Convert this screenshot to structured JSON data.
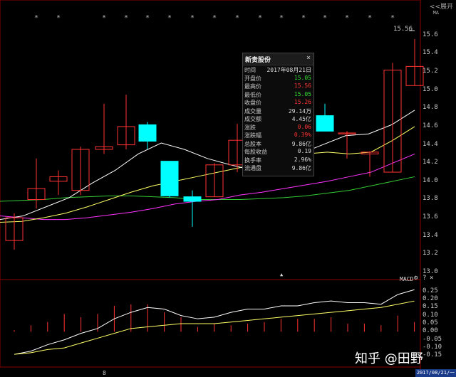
{
  "toolbar": {
    "expand_label": "<<展开"
  },
  "ma_label": "MA",
  "markers": [
    "*",
    "*",
    "*",
    "*",
    "*",
    "*",
    "*",
    "*",
    "*",
    "*",
    "*",
    "*",
    "*",
    "*",
    "*",
    "*"
  ],
  "price_axis": [
    "15.6",
    "15.4",
    "15.2",
    "15.0",
    "14.8",
    "14.6",
    "14.4",
    "14.2",
    "14.0",
    "13.8",
    "13.6",
    "13.4",
    "13.2",
    "13.0"
  ],
  "macd": {
    "title": "MACD",
    "gear": "⚙",
    "help": "?",
    "close": "×",
    "axis": [
      "0.25",
      "0.20",
      "0.15",
      "0.10",
      "0.05",
      "0.00",
      "-0.05",
      "-0.10",
      "-0.15"
    ],
    "bars": [
      0.01,
      0.04,
      0.06,
      0.11,
      0.09,
      0.11,
      0.16,
      0.17,
      0.17,
      0.12,
      0.09,
      0.03,
      0.05,
      0.04,
      0.05,
      0.06,
      0.08,
      0.08,
      0.08,
      0.09,
      0.05,
      0.05,
      0.04,
      0.1,
      0.06
    ],
    "dif": [
      -0.14,
      -0.12,
      -0.08,
      -0.05,
      -0.01,
      0.02,
      0.08,
      0.12,
      0.15,
      0.14,
      0.1,
      0.08,
      0.09,
      0.12,
      0.14,
      0.14,
      0.16,
      0.16,
      0.18,
      0.19,
      0.18,
      0.18,
      0.17,
      0.23,
      0.26
    ],
    "dea": [
      -0.14,
      -0.13,
      -0.11,
      -0.1,
      -0.07,
      -0.04,
      -0.01,
      0.02,
      0.03,
      0.04,
      0.05,
      0.05,
      0.05,
      0.06,
      0.07,
      0.08,
      0.09,
      0.1,
      0.11,
      0.12,
      0.13,
      0.14,
      0.15,
      0.17,
      0.19
    ]
  },
  "high_label": "15.56",
  "popup": {
    "title": "新贵股份",
    "close": "×",
    "rows": [
      {
        "k": "时间",
        "v": "2017年08月21日",
        "c": "#dddddd"
      },
      {
        "k": "开盘价",
        "v": "15.05",
        "c": "#33dd33"
      },
      {
        "k": "最高价",
        "v": "15.56",
        "c": "#ff3333"
      },
      {
        "k": "最低价",
        "v": "15.05",
        "c": "#33dd33"
      },
      {
        "k": "收盘价",
        "v": "15.26",
        "c": "#ff3333"
      },
      {
        "k": "成交量",
        "v": "29.14万",
        "c": "#dddddd"
      },
      {
        "k": "成交额",
        "v": "4.45亿",
        "c": "#dddddd"
      },
      {
        "k": "涨跌",
        "v": "0.06",
        "c": "#ff3333"
      },
      {
        "k": "涨跌幅",
        "v": "0.39%",
        "c": "#ff3333"
      },
      {
        "k": "总股本",
        "v": "9.86亿",
        "c": "#dddddd"
      },
      {
        "k": "每股收益",
        "v": "0.19",
        "c": "#dddddd"
      },
      {
        "k": "换手率",
        "v": "2.96%",
        "c": "#dddddd"
      },
      {
        "k": "流通盘",
        "v": "9.86亿",
        "c": "#dddddd"
      }
    ]
  },
  "watermark": "知乎 @田野",
  "date_box": "2017/08/21/一",
  "x_label": "8",
  "colors": {
    "up": "#ff3333",
    "down": "#00ffff",
    "ma5": "#ffffff",
    "ma10": "#ffff66",
    "ma20": "#ff33ff",
    "ma60": "#33cc33",
    "grid": "#8b0000"
  },
  "chart_data": {
    "type": "candlestick",
    "ylim": [
      13.0,
      15.7
    ],
    "candles": [
      {
        "o": 13.35,
        "c": 13.6,
        "h": 13.65,
        "l": 13.25
      },
      {
        "o": 13.8,
        "c": 13.92,
        "h": 14.25,
        "l": 13.7
      },
      {
        "o": 14.0,
        "c": 14.05,
        "h": 14.12,
        "l": 13.85
      },
      {
        "o": 13.9,
        "c": 14.35,
        "h": 14.38,
        "l": 13.85
      },
      {
        "o": 14.35,
        "c": 14.38,
        "h": 14.85,
        "l": 14.3
      },
      {
        "o": 14.4,
        "c": 14.6,
        "h": 14.95,
        "l": 14.35
      },
      {
        "o": 14.62,
        "c": 14.44,
        "h": 14.65,
        "l": 14.35
      },
      {
        "o": 14.22,
        "c": 13.84,
        "h": 14.22,
        "l": 13.82
      },
      {
        "o": 13.83,
        "c": 13.78,
        "h": 13.9,
        "l": 13.5
      },
      {
        "o": 13.83,
        "c": 14.18,
        "h": 14.2,
        "l": 13.83
      },
      {
        "o": 14.18,
        "c": 14.45,
        "h": 14.63,
        "l": 14.1
      },
      {
        "o": 14.32,
        "c": 14.31,
        "h": 14.33,
        "l": 14.28
      },
      {
        "o": 14.38,
        "c": 14.4,
        "h": 14.45,
        "l": 14.35
      },
      {
        "o": 14.72,
        "c": 14.55,
        "h": 14.85,
        "l": 14.55
      },
      {
        "o": 14.52,
        "c": 14.53,
        "h": 14.55,
        "l": 14.25
      },
      {
        "o": 14.3,
        "c": 14.32,
        "h": 14.33,
        "l": 14.05
      },
      {
        "o": 14.1,
        "c": 15.22,
        "h": 15.3,
        "l": 14.1
      },
      {
        "o": 15.05,
        "c": 15.26,
        "h": 15.56,
        "l": 15.05
      }
    ],
    "candle_x": [
      20,
      51,
      82,
      113,
      146,
      177,
      207,
      238,
      270,
      301,
      333,
      365,
      395,
      456,
      487,
      519,
      551,
      582
    ],
    "ma5": [
      13.58,
      13.62,
      13.72,
      13.82,
      13.98,
      14.12,
      14.3,
      14.42,
      14.35,
      14.25,
      14.18,
      14.12,
      14.15,
      14.3,
      14.4,
      14.5,
      14.52,
      14.62,
      14.78
    ],
    "ma10": [
      13.55,
      13.56,
      13.6,
      13.65,
      13.72,
      13.8,
      13.88,
      13.95,
      14.0,
      14.05,
      14.1,
      14.15,
      14.2,
      14.25,
      14.3,
      14.32,
      14.3,
      14.32,
      14.45,
      14.6
    ],
    "ma20": [
      13.62,
      13.6,
      13.58,
      13.58,
      13.6,
      13.63,
      13.66,
      13.7,
      13.75,
      13.78,
      13.8,
      13.85,
      13.88,
      13.92,
      13.96,
      14.0,
      14.05,
      14.1,
      14.2,
      14.3
    ],
    "ma60": [
      13.78,
      13.79,
      13.8,
      13.82,
      13.83,
      13.84,
      13.84,
      13.83,
      13.82,
      13.8,
      13.8,
      13.8,
      13.81,
      13.82,
      13.84,
      13.87,
      13.9,
      13.95,
      14.0,
      14.05
    ]
  }
}
